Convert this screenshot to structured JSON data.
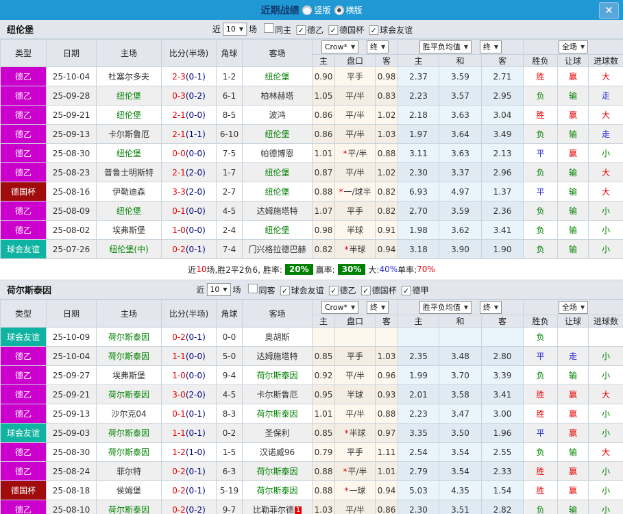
{
  "panel": {
    "title": "近期战绩",
    "radio_vertical": "竖版",
    "radio_horizontal": "横版",
    "close_icon": "✕"
  },
  "colors": {
    "titlebar": "#2098d4",
    "league": {
      "德乙": "#cc00cc",
      "德国杯": "#a00c0c",
      "球会友谊": "#0fb3a1"
    },
    "value": {
      "胜": "#e60000",
      "平": "#2b2bd5",
      "负": "#008000",
      "赢": "#e60000",
      "输": "#008000",
      "走": "#2b2bd5",
      "大": "#e60000",
      "小": "#008000"
    }
  },
  "table_headers": {
    "type": "类型",
    "date": "日期",
    "home": "主场",
    "score": "比分(半场)",
    "corner": "角球",
    "away": "客场",
    "odds_home": "主",
    "handicap": "盘口",
    "odds_away": "客",
    "avg_home": "主",
    "avg_draw": "和",
    "avg_away": "客",
    "result": "胜负",
    "let_ball": "让球",
    "goals": "进球数",
    "bookmaker_select": "Crow*",
    "final_select": "终",
    "avg_select": "胜平负均值",
    "final_select2": "终",
    "scope_select": "全场"
  },
  "sections": [
    {
      "team": "纽伦堡",
      "filter": {
        "prefix": "近",
        "count": "10",
        "suffix": "场",
        "same_label": "同主",
        "same_checked": false,
        "leagues": [
          "德乙",
          "德国杯",
          "球会友谊"
        ]
      },
      "rows": [
        {
          "league": "德乙",
          "date": "25-10-04",
          "home": "杜塞尔多夫",
          "home_team": false,
          "score": "2-3",
          "half": "(0-1)",
          "corner": "1-2",
          "away": "纽伦堡",
          "away_team": true,
          "o1": "0.90",
          "star": false,
          "pk": "平手",
          "o2": "0.98",
          "a1": "2.37",
          "a2": "3.59",
          "a3": "2.71",
          "r1": "胜",
          "r2": "赢",
          "r3": "大"
        },
        {
          "league": "德乙",
          "date": "25-09-28",
          "home": "纽伦堡",
          "home_team": true,
          "score": "0-3",
          "half": "(0-2)",
          "corner": "6-1",
          "away": "柏林赫塔",
          "away_team": false,
          "o1": "1.05",
          "star": false,
          "pk": "平/半",
          "o2": "0.83",
          "a1": "2.23",
          "a2": "3.57",
          "a3": "2.95",
          "r1": "负",
          "r2": "输",
          "r3": "走"
        },
        {
          "league": "德乙",
          "date": "25-09-21",
          "home": "纽伦堡",
          "home_team": true,
          "score": "2-1",
          "half": "(0-0)",
          "corner": "8-5",
          "away": "波鸿",
          "away_team": false,
          "o1": "0.86",
          "star": false,
          "pk": "平/半",
          "o2": "1.02",
          "a1": "2.18",
          "a2": "3.63",
          "a3": "3.04",
          "r1": "胜",
          "r2": "赢",
          "r3": "大"
        },
        {
          "league": "德乙",
          "date": "25-09-13",
          "home": "卡尔斯鲁厄",
          "home_team": false,
          "score": "2-1",
          "half": "(1-1)",
          "corner": "6-10",
          "away": "纽伦堡",
          "away_team": true,
          "o1": "0.86",
          "star": false,
          "pk": "平/半",
          "o2": "1.03",
          "a1": "1.97",
          "a2": "3.64",
          "a3": "3.49",
          "r1": "负",
          "r2": "输",
          "r3": "走"
        },
        {
          "league": "德乙",
          "date": "25-08-30",
          "home": "纽伦堡",
          "home_team": true,
          "score": "0-0",
          "half": "(0-0)",
          "corner": "7-5",
          "away": "帕德博恩",
          "away_team": false,
          "o1": "1.01",
          "star": true,
          "pk": "平/半",
          "o2": "0.88",
          "a1": "3.11",
          "a2": "3.63",
          "a3": "2.13",
          "r1": "平",
          "r2": "赢",
          "r3": "小"
        },
        {
          "league": "德乙",
          "date": "25-08-23",
          "home": "普鲁士明斯特",
          "home_team": false,
          "score": "2-1",
          "half": "(2-0)",
          "corner": "1-7",
          "away": "纽伦堡",
          "away_team": true,
          "o1": "0.87",
          "star": false,
          "pk": "平/半",
          "o2": "1.02",
          "a1": "2.30",
          "a2": "3.37",
          "a3": "2.96",
          "r1": "负",
          "r2": "输",
          "r3": "大"
        },
        {
          "league": "德国杯",
          "date": "25-08-16",
          "home": "伊勒迪森",
          "home_team": false,
          "score": "3-3",
          "half": "(2-0)",
          "corner": "2-7",
          "away": "纽伦堡",
          "away_team": true,
          "o1": "0.88",
          "star": true,
          "pk": "一/球半",
          "o2": "0.82",
          "a1": "6.93",
          "a2": "4.97",
          "a3": "1.37",
          "r1": "平",
          "r2": "输",
          "r3": "大"
        },
        {
          "league": "德乙",
          "date": "25-08-09",
          "home": "纽伦堡",
          "home_team": true,
          "score": "0-1",
          "half": "(0-0)",
          "corner": "4-5",
          "away": "达姆施塔特",
          "away_team": false,
          "o1": "1.07",
          "star": false,
          "pk": "平手",
          "o2": "0.82",
          "a1": "2.70",
          "a2": "3.59",
          "a3": "2.36",
          "r1": "负",
          "r2": "输",
          "r3": "小"
        },
        {
          "league": "德乙",
          "date": "25-08-02",
          "home": "埃弗斯堡",
          "home_team": false,
          "score": "1-0",
          "half": "(0-0)",
          "corner": "2-4",
          "away": "纽伦堡",
          "away_team": true,
          "o1": "0.98",
          "star": false,
          "pk": "半球",
          "o2": "0.91",
          "a1": "1.98",
          "a2": "3.62",
          "a3": "3.41",
          "r1": "负",
          "r2": "输",
          "r3": "小"
        },
        {
          "league": "球会友谊",
          "date": "25-07-26",
          "home": "纽伦堡(中)",
          "home_team": true,
          "score": "0-2",
          "half": "(0-1)",
          "corner": "7-4",
          "away": "门兴格拉德巴赫",
          "away_team": false,
          "o1": "0.82",
          "star": true,
          "pk": "半球",
          "o2": "0.94",
          "a1": "3.18",
          "a2": "3.90",
          "a3": "1.90",
          "r1": "负",
          "r2": "输",
          "r3": "小"
        }
      ],
      "summary": {
        "parts": [
          {
            "text": "近",
            "color": "#222"
          },
          {
            "text": "10",
            "color": "#e60000"
          },
          {
            "text": "场,胜2平2负6, 胜率:",
            "color": "#222"
          },
          {
            "text": "20%",
            "badge": true
          },
          {
            "text": "赢率:",
            "color": "#222"
          },
          {
            "text": "30%",
            "badge": true
          },
          {
            "text": "大:",
            "color": "#222"
          },
          {
            "text": "40%",
            "color": "#2b2bd5"
          },
          {
            "text": " 单率:",
            "color": "#222"
          },
          {
            "text": "70%",
            "color": "#e60000"
          }
        ]
      }
    },
    {
      "team": "荷尔斯泰因",
      "filter": {
        "prefix": "近",
        "count": "10",
        "suffix": "场",
        "same_label": "同客",
        "same_checked": false,
        "leagues": [
          "球会友谊",
          "德乙",
          "德国杯",
          "德甲"
        ]
      },
      "rows": [
        {
          "league": "球会友谊",
          "date": "25-10-09",
          "home": "荷尔斯泰因",
          "home_team": true,
          "score": "0-2",
          "half": "(0-1)",
          "corner": "0-0",
          "away": "奥胡斯",
          "away_team": false,
          "o1": "",
          "star": false,
          "pk": "",
          "o2": "",
          "a1": "",
          "a2": "",
          "a3": "",
          "r1": "负",
          "r2": "",
          "r3": ""
        },
        {
          "league": "德乙",
          "date": "25-10-04",
          "home": "荷尔斯泰因",
          "home_team": true,
          "score": "1-1",
          "half": "(0-0)",
          "corner": "5-0",
          "away": "达姆施塔特",
          "away_team": false,
          "o1": "0.85",
          "star": false,
          "pk": "平手",
          "o2": "1.03",
          "a1": "2.35",
          "a2": "3.48",
          "a3": "2.80",
          "r1": "平",
          "r2": "走",
          "r3": "小"
        },
        {
          "league": "德乙",
          "date": "25-09-27",
          "home": "埃弗斯堡",
          "home_team": false,
          "score": "1-0",
          "half": "(0-0)",
          "corner": "9-4",
          "away": "荷尔斯泰因",
          "away_team": true,
          "o1": "0.92",
          "star": false,
          "pk": "平/半",
          "o2": "0.96",
          "a1": "1.99",
          "a2": "3.70",
          "a3": "3.39",
          "r1": "负",
          "r2": "输",
          "r3": "小"
        },
        {
          "league": "德乙",
          "date": "25-09-21",
          "home": "荷尔斯泰因",
          "home_team": true,
          "score": "3-0",
          "half": "(2-0)",
          "corner": "4-5",
          "away": "卡尔斯鲁厄",
          "away_team": false,
          "o1": "0.95",
          "star": false,
          "pk": "半球",
          "o2": "0.93",
          "a1": "2.01",
          "a2": "3.58",
          "a3": "3.41",
          "r1": "胜",
          "r2": "赢",
          "r3": "大"
        },
        {
          "league": "德乙",
          "date": "25-09-13",
          "home": "沙尔克04",
          "home_team": false,
          "score": "0-1",
          "half": "(0-1)",
          "corner": "8-3",
          "away": "荷尔斯泰因",
          "away_team": true,
          "o1": "1.01",
          "star": false,
          "pk": "平/半",
          "o2": "0.88",
          "a1": "2.23",
          "a2": "3.47",
          "a3": "3.00",
          "r1": "胜",
          "r2": "赢",
          "r3": "小"
        },
        {
          "league": "球会友谊",
          "date": "25-09-03",
          "home": "荷尔斯泰因",
          "home_team": true,
          "score": "1-1",
          "half": "(0-1)",
          "corner": "0-2",
          "away": "圣保利",
          "away_team": false,
          "o1": "0.85",
          "star": true,
          "pk": "半球",
          "o2": "0.97",
          "a1": "3.35",
          "a2": "3.50",
          "a3": "1.96",
          "r1": "平",
          "r2": "赢",
          "r3": "小"
        },
        {
          "league": "德乙",
          "date": "25-08-30",
          "home": "荷尔斯泰因",
          "home_team": true,
          "score": "1-2",
          "half": "(1-0)",
          "corner": "1-5",
          "away": "汉诺威96",
          "away_team": false,
          "o1": "0.79",
          "star": false,
          "pk": "平手",
          "o2": "1.11",
          "a1": "2.54",
          "a2": "3.54",
          "a3": "2.55",
          "r1": "负",
          "r2": "输",
          "r3": "大"
        },
        {
          "league": "德乙",
          "date": "25-08-24",
          "home": "菲尔特",
          "home_team": false,
          "score": "0-2",
          "half": "(0-1)",
          "corner": "6-3",
          "away": "荷尔斯泰因",
          "away_team": true,
          "o1": "0.88",
          "star": true,
          "pk": "平/半",
          "o2": "1.01",
          "a1": "2.79",
          "a2": "3.54",
          "a3": "2.33",
          "r1": "胜",
          "r2": "赢",
          "r3": "小"
        },
        {
          "league": "德国杯",
          "date": "25-08-18",
          "home": "侯姆堡",
          "home_team": false,
          "score": "0-2",
          "half": "(0-1)",
          "corner": "5-19",
          "away": "荷尔斯泰因",
          "away_team": true,
          "o1": "0.88",
          "star": true,
          "pk": "一球",
          "o2": "0.94",
          "a1": "5.03",
          "a2": "4.35",
          "a3": "1.54",
          "r1": "胜",
          "r2": "赢",
          "r3": "小"
        },
        {
          "league": "德乙",
          "date": "25-08-10",
          "home": "荷尔斯泰因",
          "home_team": true,
          "score": "0-2",
          "half": "(0-2)",
          "corner": "9-7",
          "away": "比勒菲尔德",
          "away_team": false,
          "away_badge": "1",
          "o1": "1.03",
          "star": false,
          "pk": "平/半",
          "o2": "0.86",
          "a1": "2.30",
          "a2": "3.51",
          "a3": "2.82",
          "r1": "负",
          "r2": "输",
          "r3": "小"
        }
      ]
    }
  ]
}
